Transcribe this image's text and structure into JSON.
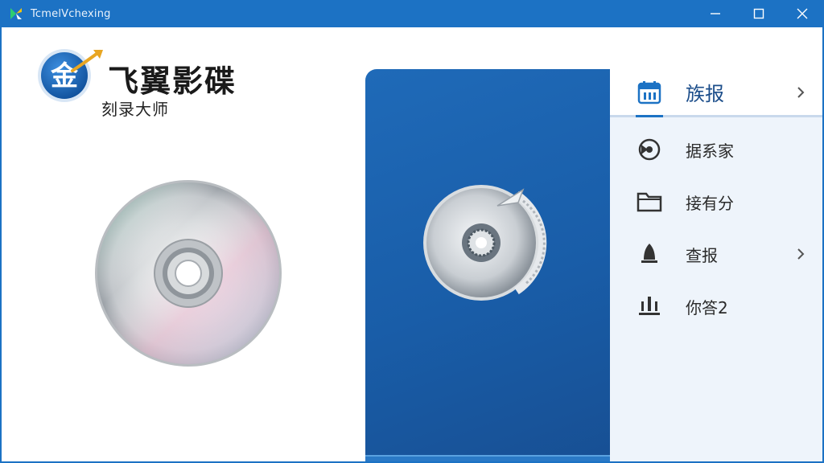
{
  "window": {
    "title": "TcmelVchexing",
    "icon": "app-logo-icon",
    "accent_color": "#1c72c4",
    "controls": [
      "minimize-icon",
      "maximize-icon",
      "close-icon"
    ]
  },
  "logo": {
    "emblem_char": "金",
    "name": "飞翼影碟",
    "subtitle": "刻录大师"
  },
  "menu": {
    "items": [
      {
        "label": "族报",
        "icon": "calendar-icon",
        "active": true,
        "has_submenu": true
      },
      {
        "label": "据系家",
        "icon": "disc-burn-icon",
        "active": false,
        "has_submenu": false
      },
      {
        "label": "接有分",
        "icon": "folder-icon",
        "active": false,
        "has_submenu": false
      },
      {
        "label": "查报",
        "icon": "bell-icon",
        "active": false,
        "has_submenu": true
      },
      {
        "label": "你答2",
        "icon": "equalizer-icon",
        "active": false,
        "has_submenu": false
      }
    ]
  },
  "colors": {
    "panel_blue": "#195da8",
    "menu_bg": "#eef4fb",
    "active_bg": "#ffffff"
  }
}
